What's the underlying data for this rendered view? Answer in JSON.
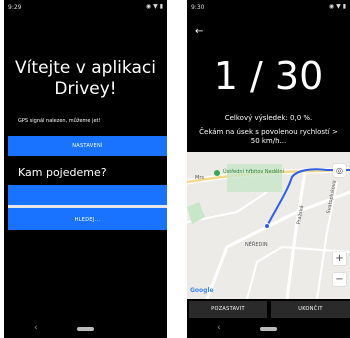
{
  "screen1": {
    "status_time": "9:29",
    "welcome_line1": "Vítejte v aplikaci",
    "welcome_line2": "Drivey!",
    "gps_text": "GPS signál nalezen, můžeme jet!",
    "settings_button": "NASTAVENÍ",
    "question": "Kam pojedeme?",
    "search_input_value": "",
    "search_button": "HLEDEJ..."
  },
  "screen2": {
    "status_time": "9:30",
    "counter": "1 / 30",
    "total_result": "Celkový výsledek: 0,0 %.",
    "waiting_text": "Čekám na úsek s povolenou rychlostí >\n50 km/h...",
    "map": {
      "poi_label": "Ústřední hřbitov Nedělní",
      "district_label": "NĚŘEDIN",
      "street_label_1": "Mrs",
      "street_label_2": "Pražská",
      "street_label_3": "Svatoplukova",
      "logo": "Google",
      "zoom_in": "+",
      "zoom_out": "−",
      "route_color": "#2f5ee8"
    },
    "pause_button": "POZASTAVIT",
    "end_button": "UKONČIT"
  },
  "colors": {
    "accent": "#1a73ff",
    "background": "#000000",
    "secondary_button": "#2a2a2a"
  }
}
